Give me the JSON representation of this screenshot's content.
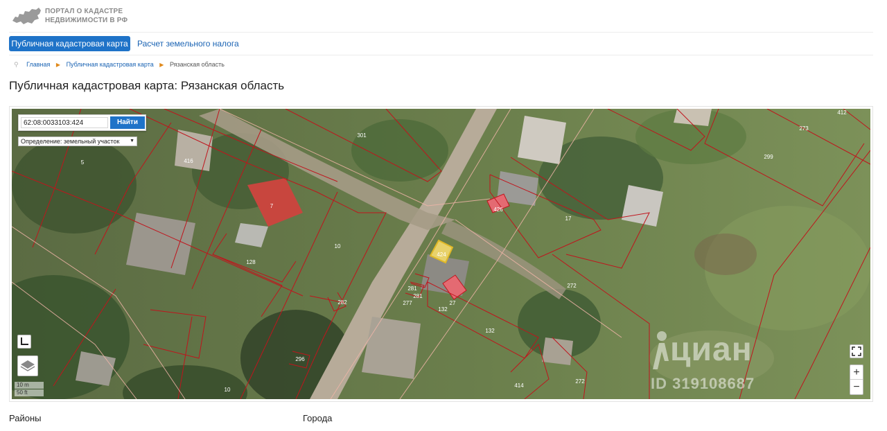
{
  "header": {
    "logo_line1": "ПОРТАЛ О КАДАСТРЕ",
    "logo_line2": "НЕДВИЖИМОСТИ В РФ"
  },
  "tabs": {
    "active": "Публичная кадастровая карта",
    "link": "Расчет земельного налога"
  },
  "breadcrumb": {
    "items": [
      "Главная",
      "Публичная кадастровая карта"
    ],
    "current": "Рязанская область"
  },
  "page_title": "Публичная кадастровая карта: Рязанская область",
  "map": {
    "search_value": "62:08:0033103:424",
    "search_button": "Найти",
    "definition_label": "Определение: земельный участок",
    "scale_m": "10 m",
    "scale_ft": "50 ft",
    "zoom_in": "+",
    "zoom_out": "−",
    "watermark": "циан",
    "watermark_id": "ID 319108687",
    "parcel_labels": {
      "p301": "301",
      "p416": "416",
      "p5": "5",
      "p7": "7",
      "p10": "10",
      "p128": "128",
      "p282": "282",
      "p281a": "281",
      "p281b": "281",
      "p277": "277",
      "p132a": "132",
      "p132b": "132",
      "p27": "27",
      "p424": "424",
      "p426": "426",
      "p17": "17",
      "p272a": "272",
      "p272b": "272",
      "p273": "273",
      "p299": "299",
      "p412": "412",
      "p296": "296",
      "p414": "414",
      "p10b": "10"
    }
  },
  "bottom": {
    "districts": "Районы",
    "cities": "Города"
  },
  "colors": {
    "accent": "#1f73c8",
    "parcel_border": "#c0141c",
    "selected_parcel": "#e7c84a"
  }
}
